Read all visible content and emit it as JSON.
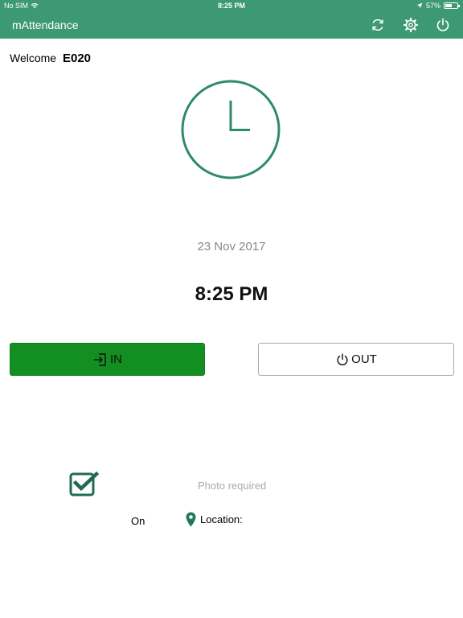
{
  "status_bar": {
    "carrier": "No SIM",
    "time": "8:25 PM",
    "battery": "57%",
    "battery_level": 0.57,
    "icons": [
      "wifi-icon",
      "location-arrow-icon",
      "battery-icon"
    ]
  },
  "nav": {
    "title": "mAttendance",
    "icons": [
      "refresh-icon",
      "gear-icon",
      "power-icon"
    ]
  },
  "welcome": {
    "label": "Welcome",
    "user": "E020"
  },
  "clock": {
    "date": "23 Nov 2017",
    "time": "8:25 PM",
    "icon": "clock-icon"
  },
  "buttons": {
    "in_label": "IN",
    "out_label": "OUT",
    "in_icon": "sign-in-icon",
    "out_icon": "power-icon"
  },
  "options": {
    "photo_required_label": "Photo required",
    "photo_required_checked": true,
    "on_label": "On",
    "location_label": "Location:",
    "location_icon": "map-pin-icon"
  },
  "colors": {
    "header": "#3d9974",
    "in_button": "#138f22",
    "accent": "#2e8b6a"
  }
}
